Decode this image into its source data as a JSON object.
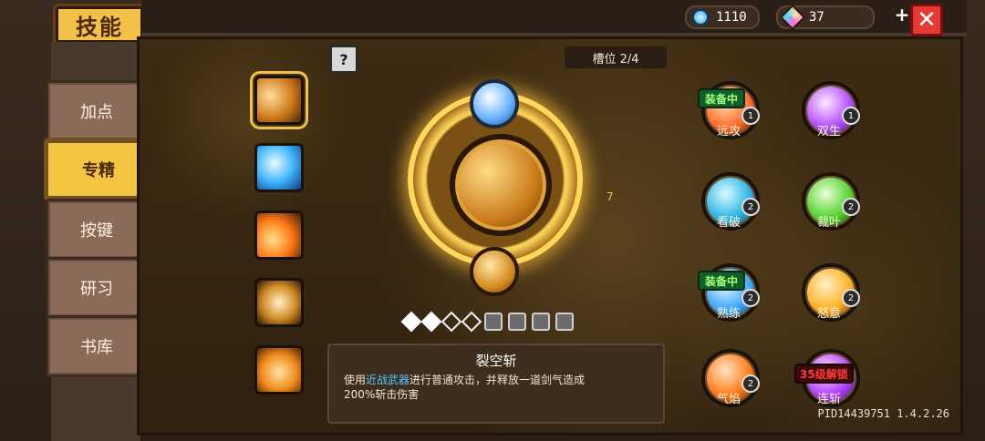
{
  "header": {
    "title": "技能",
    "currency_gems": "1110",
    "currency_crystals": "37",
    "add_symbol": "+"
  },
  "sidebar": {
    "items": [
      {
        "label": "加点"
      },
      {
        "label": "专精"
      },
      {
        "label": "按键"
      },
      {
        "label": "研习"
      },
      {
        "label": "书库"
      }
    ],
    "selected_index": 1
  },
  "main": {
    "help_symbol": "?",
    "slot_label": "槽位 2/4",
    "side_number": "7",
    "selected_skill": {
      "name": "裂空斩",
      "desc_prefix": "使用",
      "desc_keyword": "近战武器",
      "desc_suffix": "进行普通攻击，并释放一道剑气造成",
      "desc_line2": "200%斩击伤害"
    },
    "left_skills": [
      {
        "icon": "moon-slash-icon"
      },
      {
        "icon": "ice-shatter-icon"
      },
      {
        "icon": "fire-dash-icon"
      },
      {
        "icon": "whirlwind-icon"
      },
      {
        "icon": "flame-burst-icon"
      }
    ],
    "progress": {
      "filled": 2,
      "hollow": 2,
      "locked": 4
    },
    "skills": [
      {
        "label": "远攻",
        "badge": "1",
        "tag": "装备中"
      },
      {
        "label": "双生",
        "badge": "1",
        "tag": ""
      },
      {
        "label": "看破",
        "badge": "2",
        "tag": ""
      },
      {
        "label": "裁叶",
        "badge": "2",
        "tag": ""
      },
      {
        "label": "熟练",
        "badge": "2",
        "tag": "装备中"
      },
      {
        "label": "怒意",
        "badge": "2",
        "tag": ""
      },
      {
        "label": "气焰",
        "badge": "2",
        "tag": ""
      },
      {
        "label": "连斩",
        "badge": "",
        "tag": "35级解锁"
      }
    ],
    "pid": "PID14439751 1.4.2.26"
  },
  "colors": {
    "accent_gold": "#f3c04a",
    "equipped_green": "#a6ff7a",
    "lock_red": "#ff3b3b",
    "keyword_blue": "#59c8ff"
  }
}
